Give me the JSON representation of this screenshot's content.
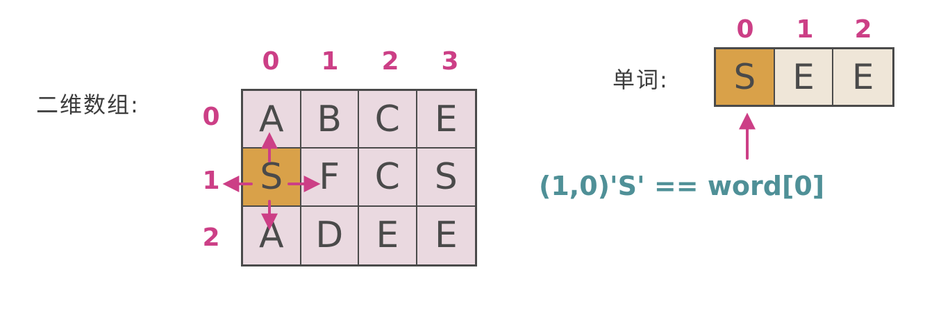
{
  "array_label": "二维数组:",
  "word_label": "单词:",
  "col_indices": [
    "0",
    "1",
    "2",
    "3"
  ],
  "row_indices": [
    "0",
    "1",
    "2"
  ],
  "grid": [
    [
      "A",
      "B",
      "C",
      "E"
    ],
    [
      "S",
      "F",
      "C",
      "S"
    ],
    [
      "A",
      "D",
      "E",
      "E"
    ]
  ],
  "word_indices": [
    "0",
    "1",
    "2"
  ],
  "word": [
    "S",
    "E",
    "E"
  ],
  "note": "(1,0)'S' == word[0]",
  "colors": {
    "cell": "#ead9e0",
    "highlight": "#d9a149",
    "word_cell": "#efe6d8",
    "index": "#cc3f86",
    "arrow": "#cc3f86",
    "note": "#4f9097",
    "ink": "#4a4a4a"
  }
}
